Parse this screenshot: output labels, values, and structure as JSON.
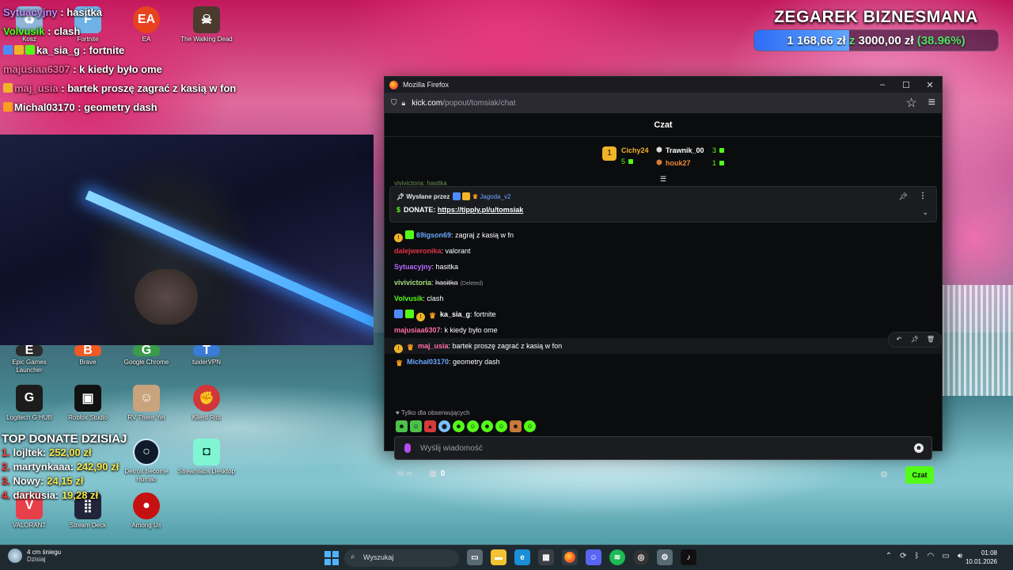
{
  "overlay_chat": [
    {
      "user": "Sytuacyjny",
      "text": "hasitka",
      "user_color": "#c58cff",
      "badges": []
    },
    {
      "user": "Volvusik",
      "text": "clash",
      "user_color": "#53fc18",
      "badges": []
    },
    {
      "user": "ka_sia_g",
      "text": "fortnite",
      "user_color": "#ffffff",
      "badges": [
        "#4d8cff",
        "#f0b429",
        "#53fc18"
      ]
    },
    {
      "user": "majusiaa6307",
      "text": "k kiedy było ome",
      "user_color": "#ff6fa8",
      "badges": []
    },
    {
      "user": "maj_usia",
      "text": "bartek proszę zagrać z kasią w fon",
      "user_color": "#ff6fa8",
      "badges": [
        "#f0b429"
      ]
    },
    {
      "user": "Michal03170",
      "text": "geometry dash",
      "user_color": "#ffffff",
      "badges": [
        "#ff9d1f"
      ]
    }
  ],
  "donate_goal": {
    "title": "ZEGAREK BIZNESMANA",
    "current": "1 168,66 zł",
    "z": "z",
    "target": "3000,00 zł",
    "percent_text": "(38.96%)",
    "progress": 0.3896
  },
  "top_donate": {
    "title": "TOP DONATE DZISIAJ",
    "rows": [
      {
        "rank": "1.",
        "name": "lojltek:",
        "amount": "252,00 zł"
      },
      {
        "rank": "2.",
        "name": "martynkaaa:",
        "amount": "242,90 zł"
      },
      {
        "rank": "3.",
        "name": "Nowy:",
        "amount": "24,15 zł"
      },
      {
        "rank": "4.",
        "name": "darkusia:",
        "amount": "19,28 zł"
      }
    ]
  },
  "desktop_icons": {
    "kosz": "Kosz",
    "fortnite": "Fortnite",
    "ea": "EA",
    "twd": "The Walking Dead",
    "epic": "Epic Games Launcher",
    "brave": "Brave",
    "chrome": "Google Chrome",
    "tuxler": "tuxlerVPN",
    "logitech": "Logitech G HUB",
    "roblox": "Roblox Studio",
    "rvthere": "RV There Yet",
    "riot": "Klient Riot",
    "detroit": "Detroit Become Human",
    "streamlabs": "Streamlabs Desktop",
    "valorant": "VALORANT",
    "streamdeck": "Stream Deck",
    "amongus": "Among Us"
  },
  "firefox": {
    "title": "Mozilla Firefox",
    "url_host": "kick.com",
    "url_path": "/popout/tomsiak/chat"
  },
  "kick": {
    "header": "Czat",
    "leaderboard": {
      "first": {
        "name": "Cichy24",
        "count": "5"
      },
      "second": {
        "name": "Trawnik_00",
        "count": "3"
      },
      "third": {
        "name": "houk27",
        "count": "1"
      }
    },
    "faded_line": "vivivictoria: hasitka",
    "pinned": {
      "sent_by_label": "Wysłane przez",
      "sent_by_user": "Jagoda_v2",
      "body_prefix": "DONATE:",
      "body_link": "https://tippIy.pl/u/tomsiak"
    },
    "messages": [
      {
        "user": "69igson69",
        "color": "#6aa7ff",
        "text": ": zagraj z kasią w fn"
      },
      {
        "user": "dalejweronika",
        "color": "#e0334a",
        "text": ": valorant"
      },
      {
        "user": "Sytuacyjny",
        "color": "#b86bff",
        "text": ": hasitka"
      },
      {
        "user": "vivivictoria",
        "color": "#a1e17d",
        "text": "hasitka",
        "deleted_tag": "(Deleted)"
      },
      {
        "user": "Volvusik",
        "color": "#53fc18",
        "text": ": clash"
      },
      {
        "user": "ka_sia_g",
        "color": "#ffffff",
        "text": ": fortnite"
      },
      {
        "user": "majusiaa6307",
        "color": "#ff6fa8",
        "text": ": k kiedy było ome"
      },
      {
        "user": "maj_usia",
        "color": "#ff6fa8",
        "text": ": bartek proszę zagrać z kasią w fon"
      },
      {
        "user": "Michal03170",
        "color": "#6aa7ff",
        "text": ": geometry dash"
      }
    ],
    "followers_only": "Tylko dla obserwujących",
    "input_placeholder": "Wyślij wiadomość",
    "infinity_symbol": "∞",
    "store_count": "0",
    "send_label": "Czat"
  },
  "taskbar": {
    "weather_line1": "4 cm śniegu",
    "weather_line2": "Dzisiaj",
    "search_label": "Wyszukaj",
    "time": "01:08",
    "date": "10.01.2026"
  },
  "colors": {
    "kick_green": "#53fc18",
    "goal_blue": "#2f6cf5"
  }
}
